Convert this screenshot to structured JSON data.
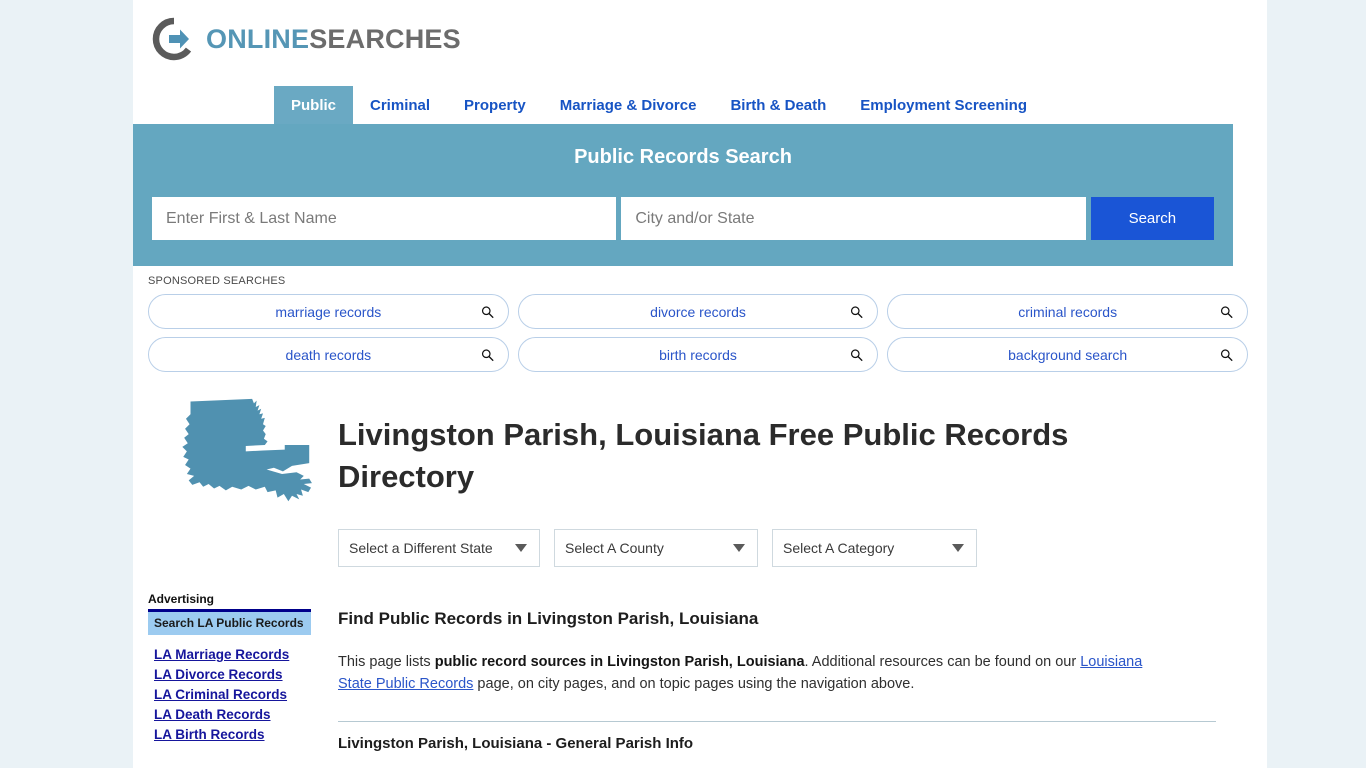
{
  "brand": {
    "name_part1": "ONLINE",
    "name_part2": "SEARCHES",
    "logo_icon": "circle-arrow-icon",
    "accent_blue": "#5596b5",
    "accent_gray": "#6c6c6c"
  },
  "nav": {
    "tabs": [
      {
        "label": "Public",
        "active": true
      },
      {
        "label": "Criminal",
        "active": false
      },
      {
        "label": "Property",
        "active": false
      },
      {
        "label": "Marriage & Divorce",
        "active": false
      },
      {
        "label": "Birth & Death",
        "active": false
      },
      {
        "label": "Employment Screening",
        "active": false
      }
    ]
  },
  "banner": {
    "title": "Public Records Search",
    "background_color": "#64a7c0",
    "name_input": {
      "value": "",
      "placeholder": "Enter First & Last Name"
    },
    "city_input": {
      "value": "",
      "placeholder": "City and/or State"
    },
    "search_button": "Search",
    "search_button_color": "#1a55d6"
  },
  "sponsored": {
    "label": "SPONSORED SEARCHES",
    "rows": [
      [
        {
          "label": "marriage records",
          "icon": "magnifier-icon"
        },
        {
          "label": "divorce records",
          "icon": "magnifier-icon"
        },
        {
          "label": "criminal records",
          "icon": "magnifier-icon"
        }
      ],
      [
        {
          "label": "death records",
          "icon": "magnifier-icon"
        },
        {
          "label": "birth records",
          "icon": "magnifier-icon"
        },
        {
          "label": "background search",
          "icon": "magnifier-icon"
        }
      ]
    ]
  },
  "sidebar": {
    "map_icon": "louisiana-state-map",
    "map_color": "#5091b0",
    "ad_title": "Advertising",
    "ad_header": "Search LA Public Records",
    "links": [
      "LA Marriage Records",
      "LA Divorce Records",
      "LA Criminal Records",
      "LA Death Records",
      "LA Birth Records"
    ]
  },
  "main": {
    "page_title": "Livingston Parish, Louisiana Free Public Records Directory",
    "selects": [
      {
        "value": "Select a Different State",
        "icon": "chevron-down-icon"
      },
      {
        "value": "Select A County",
        "icon": "chevron-down-icon"
      },
      {
        "value": "Select A Category",
        "icon": "chevron-down-icon"
      }
    ],
    "section_title": "Find Public Records in Livingston Parish, Louisiana",
    "intro": {
      "part1": "This page lists ",
      "bold1": "public record sources in Livingston Parish, Louisiana",
      "part2": ". Additional resources can be found on our ",
      "link": "Louisiana State Public Records",
      "part3": " page, on city pages, and on topic pages using the navigation above."
    },
    "table_heading": "Livingston Parish, Louisiana - General Parish Info"
  }
}
